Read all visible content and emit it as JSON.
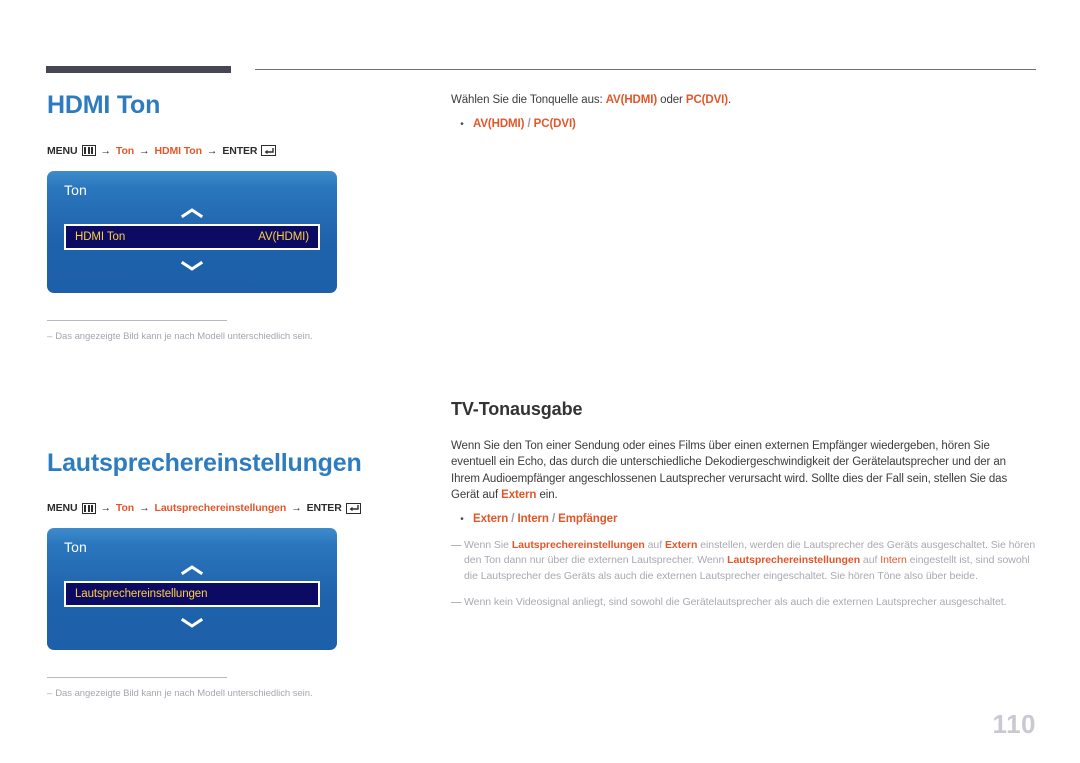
{
  "page": {
    "number": "110"
  },
  "sections": [
    {
      "title": "HDMI Ton",
      "breadcrumb": {
        "menu_label": "MENU",
        "menu_icon": "menu-bars-icon",
        "arrow": "→",
        "path_1": "Ton",
        "path_2": "HDMI Ton",
        "enter_label": "ENTER",
        "enter_icon": "enter-return-icon"
      },
      "osd": {
        "title": "Ton",
        "chevron_up": "chevron-up-icon",
        "chevron_down": "chevron-down-icon",
        "row_label": "HDMI Ton",
        "row_value": "AV(HDMI)"
      },
      "footnote": "Das angezeigte Bild kann je nach Modell unterschiedlich sein.",
      "footnote_dash": "–"
    },
    {
      "title": "Lautsprechereinstellungen",
      "breadcrumb": {
        "menu_label": "MENU",
        "menu_icon": "menu-bars-icon",
        "arrow": "→",
        "path_1": "Ton",
        "path_2": "Lautsprechereinstellungen",
        "enter_label": "ENTER",
        "enter_icon": "enter-return-icon"
      },
      "osd": {
        "title": "Ton",
        "chevron_up": "chevron-up-icon",
        "chevron_down": "chevron-down-icon",
        "row_label": "Lautsprechereinstellungen",
        "row_value": ""
      },
      "footnote": "Das angezeigte Bild kann je nach Modell unterschiedlich sein.",
      "footnote_dash": "–"
    }
  ],
  "right": {
    "hdmi": {
      "intro_pre": "Wählen Sie die Tonquelle aus: ",
      "intro_opt1": "AV(HDMI)",
      "intro_mid": " oder ",
      "intro_opt2": "PC(DVI)",
      "intro_post": ".",
      "bullet_dot": "•",
      "bullet_opt1": "AV(HDMI)",
      "bullet_sep": " / ",
      "bullet_opt2": "PC(DVI)"
    },
    "tv_output": {
      "heading": "TV-Tonausgabe",
      "paragraph_pre": "Wenn Sie den Ton einer Sendung oder eines Films über einen externen Empfänger wiedergeben, hören Sie eventuell ein Echo, das durch die unterschiedliche Dekodiergeschwindigkeit der Gerätelautsprecher und der an Ihrem Audioempfänger angeschlossenen Lautsprecher verursacht wird. Sollte dies der Fall sein, stellen Sie das Gerät auf ",
      "paragraph_accent": "Extern",
      "paragraph_post": " ein.",
      "bullet_dot": "•",
      "bullet_opt1": "Extern",
      "bullet_sep1": " / ",
      "bullet_opt2": "Intern",
      "bullet_sep2": " / ",
      "bullet_opt3": "Empfänger",
      "note1": {
        "dash": "―",
        "t1": "Wenn Sie ",
        "a1": "Lautsprechereinstellungen",
        "t2": " auf ",
        "a2": "Extern",
        "t3": " einstellen, werden die Lautsprecher des Geräts ausgeschaltet. Sie hören den Ton dann nur über die externen Lautsprecher. Wenn ",
        "a3": "Lautsprechereinstellungen",
        "t4": " auf ",
        "a4": "Intern",
        "t5": " eingestellt ist, sind sowohl die Lautsprecher des Geräts als auch die externen Lautsprecher eingeschaltet. Sie hören Töne also über beide."
      },
      "note2": {
        "dash": "―",
        "text": "Wenn kein Videosignal anliegt, sind sowohl die Gerätelautsprecher als auch die externen Lautsprecher ausgeschaltet."
      }
    }
  },
  "colors": {
    "heading_blue": "#2e7cc0",
    "accent_orange": "#e2572a",
    "osd_blue": "#1f63ad",
    "osd_row_navy": "#0b0b63",
    "osd_row_yellow": "#ffcf3f",
    "muted_gray": "#a9a9b2",
    "rule_dark": "#474754"
  }
}
